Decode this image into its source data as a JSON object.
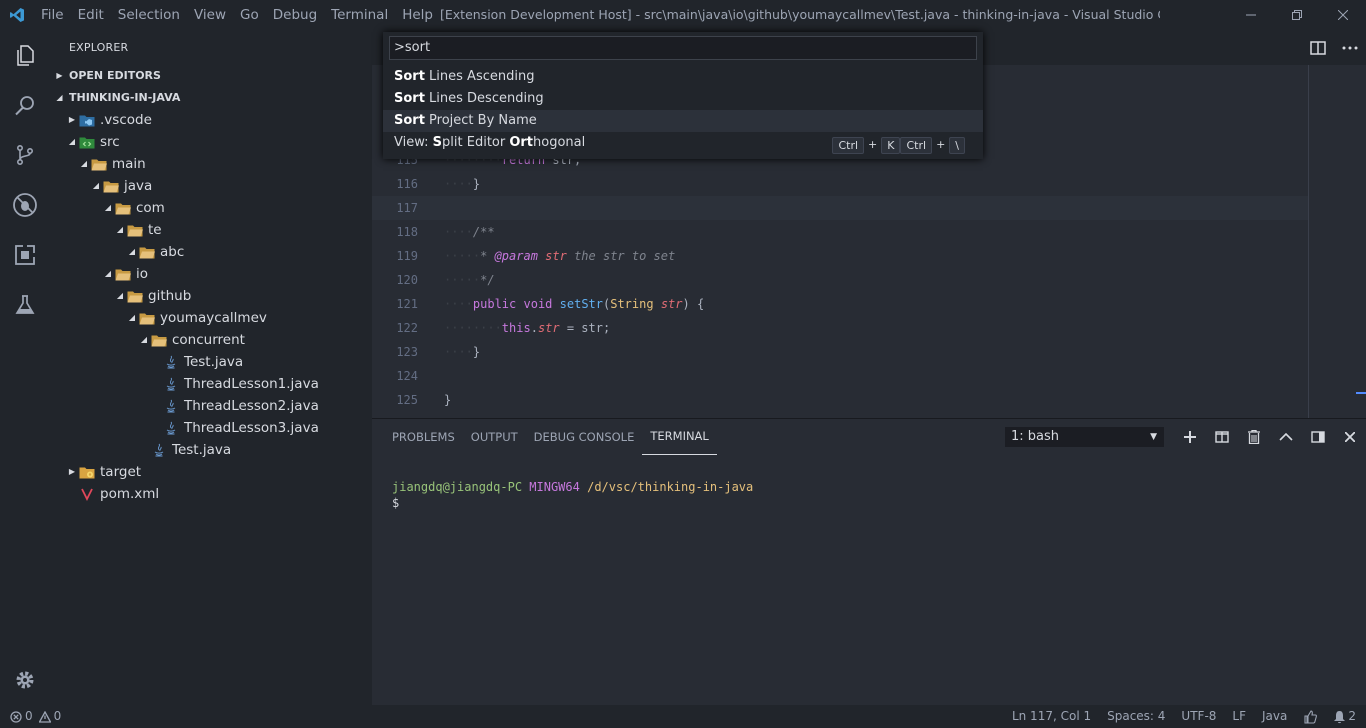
{
  "menu": [
    "File",
    "Edit",
    "Selection",
    "View",
    "Go",
    "Debug",
    "Terminal",
    "Help"
  ],
  "window_title": "[Extension Development Host] - src\\main\\java\\io\\github\\youmaycallmev\\Test.java - thinking-in-java - Visual Studio Code",
  "sidebar": {
    "title": "EXPLORER",
    "open_editors": "OPEN EDITORS",
    "project": "THINKING-IN-JAVA",
    "tree": [
      {
        "label": ".vscode",
        "depth": 0,
        "twisty": "closed",
        "icon": "vscode-folder-icon"
      },
      {
        "label": "src",
        "depth": 0,
        "twisty": "open",
        "icon": "src-folder-icon"
      },
      {
        "label": "main",
        "depth": 1,
        "twisty": "open",
        "icon": "folder-open-icon"
      },
      {
        "label": "java",
        "depth": 2,
        "twisty": "open",
        "icon": "folder-open-icon"
      },
      {
        "label": "com",
        "depth": 3,
        "twisty": "open",
        "icon": "folder-open-icon"
      },
      {
        "label": "te",
        "depth": 4,
        "twisty": "open",
        "icon": "folder-open-icon"
      },
      {
        "label": "abc",
        "depth": 5,
        "twisty": "open",
        "icon": "folder-open-icon"
      },
      {
        "label": "io",
        "depth": 3,
        "twisty": "open",
        "icon": "folder-open-icon"
      },
      {
        "label": "github",
        "depth": 4,
        "twisty": "open",
        "icon": "folder-open-icon"
      },
      {
        "label": "youmaycallmev",
        "depth": 5,
        "twisty": "open",
        "icon": "folder-open-icon"
      },
      {
        "label": "concurrent",
        "depth": 6,
        "twisty": "open",
        "icon": "folder-open-icon"
      },
      {
        "label": "Test.java",
        "depth": 7,
        "twisty": "none",
        "icon": "java-file-icon"
      },
      {
        "label": "ThreadLesson1.java",
        "depth": 7,
        "twisty": "none",
        "icon": "java-file-icon"
      },
      {
        "label": "ThreadLesson2.java",
        "depth": 7,
        "twisty": "none",
        "icon": "java-file-icon"
      },
      {
        "label": "ThreadLesson3.java",
        "depth": 7,
        "twisty": "none",
        "icon": "java-file-icon"
      },
      {
        "label": "Test.java",
        "depth": 6,
        "twisty": "none",
        "icon": "java-file-icon"
      },
      {
        "label": "target",
        "depth": 0,
        "twisty": "closed",
        "icon": "target-folder-icon"
      },
      {
        "label": "pom.xml",
        "depth": 0,
        "twisty": "none",
        "icon": "maven-file-icon"
      }
    ]
  },
  "palette": {
    "query": ">sort",
    "items": [
      {
        "parts": [
          [
            "Sort",
            true
          ],
          [
            " Lines Ascending",
            false
          ]
        ],
        "selected": false,
        "keys": []
      },
      {
        "parts": [
          [
            "Sort",
            true
          ],
          [
            " Lines Descending",
            false
          ]
        ],
        "selected": false,
        "keys": []
      },
      {
        "parts": [
          [
            "Sort",
            true
          ],
          [
            " Project By Name",
            false
          ]
        ],
        "selected": true,
        "keys": []
      },
      {
        "parts": [
          [
            "View: ",
            false
          ],
          [
            "S",
            true
          ],
          [
            "plit Editor ",
            false
          ],
          [
            "Ort",
            true
          ],
          [
            "hogonal",
            false
          ]
        ],
        "selected": false,
        "keys": [
          "Ctrl",
          "+",
          "K",
          "Ctrl",
          "+",
          "\\"
        ]
      }
    ]
  },
  "code": [
    {
      "n": "115",
      "tokens": [
        [
          "ws",
          "········"
        ],
        [
          "kw",
          "return"
        ],
        [
          "",
          " str;"
        ]
      ]
    },
    {
      "n": "116",
      "tokens": [
        [
          "ws",
          "····"
        ],
        [
          "",
          "}"
        ]
      ]
    },
    {
      "n": "117",
      "tokens": [],
      "current": true
    },
    {
      "n": "118",
      "tokens": [
        [
          "ws",
          "····"
        ],
        [
          "cm",
          "/**"
        ]
      ]
    },
    {
      "n": "119",
      "tokens": [
        [
          "ws",
          "·····"
        ],
        [
          "cm",
          "* "
        ],
        [
          "tag",
          "@param"
        ],
        [
          "cm",
          " "
        ],
        [
          "pm",
          "str"
        ],
        [
          "cm",
          " the str to set"
        ]
      ]
    },
    {
      "n": "120",
      "tokens": [
        [
          "ws",
          "·····"
        ],
        [
          "cm",
          "*/"
        ]
      ]
    },
    {
      "n": "121",
      "tokens": [
        [
          "ws",
          "····"
        ],
        [
          "kw",
          "public"
        ],
        [
          "",
          " "
        ],
        [
          "kw",
          "void"
        ],
        [
          "",
          " "
        ],
        [
          "fn",
          "setStr"
        ],
        [
          "",
          "("
        ],
        [
          "ty",
          "String"
        ],
        [
          "",
          " "
        ],
        [
          "pm",
          "str"
        ],
        [
          "",
          ") {"
        ]
      ]
    },
    {
      "n": "122",
      "tokens": [
        [
          "ws",
          "········"
        ],
        [
          "kw",
          "this"
        ],
        [
          "",
          "."
        ],
        [
          "pm",
          "str"
        ],
        [
          "",
          " = str;"
        ]
      ]
    },
    {
      "n": "123",
      "tokens": [
        [
          "ws",
          "····"
        ],
        [
          "",
          "}"
        ]
      ]
    },
    {
      "n": "124",
      "tokens": []
    },
    {
      "n": "125",
      "tokens": [
        [
          "",
          "}"
        ]
      ]
    }
  ],
  "panel": {
    "tabs": [
      "PROBLEMS",
      "OUTPUT",
      "DEBUG CONSOLE",
      "TERMINAL"
    ],
    "active_tab": "TERMINAL",
    "terminal_select": "1: bash",
    "terminal_user": "jiangdq@jiangdq-PC",
    "terminal_sys": "MINGW64",
    "terminal_path": "/d/vsc/thinking-in-java",
    "terminal_prompt": "$"
  },
  "status": {
    "errors": "0",
    "warnings": "0",
    "position": "Ln 117, Col 1",
    "spaces": "Spaces: 4",
    "encoding": "UTF-8",
    "eol": "LF",
    "language": "Java",
    "notifications": "2"
  },
  "colors": {
    "accent": "#528bff",
    "keyword": "#c678dd",
    "function": "#61afef",
    "type": "#e5c07b",
    "param": "#e06c75",
    "comment": "#7f848e"
  }
}
